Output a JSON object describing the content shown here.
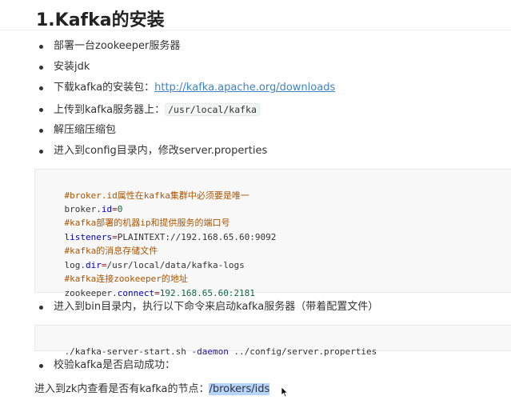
{
  "heading": {
    "title": "1.Kafka的安装"
  },
  "steps": [
    {
      "text": "部署一台zookeeper服务器"
    },
    {
      "text": "安装jdk"
    },
    {
      "text": "下载kafka的安装包：",
      "link": "http://kafka.apache.org/downloads"
    },
    {
      "text": "上传到kafka服务器上：",
      "code": "/usr/local/kafka"
    },
    {
      "text": "解压缩压缩包"
    },
    {
      "text": "进入到config目录内，修改server.properties"
    }
  ],
  "config_block": {
    "lines": [
      {
        "comment": "#broker.id属性在kafka集群中必须要是唯一"
      },
      {
        "prefix": "broker.",
        "prop": "id",
        "op": "=",
        "value": "0"
      },
      {
        "comment": "#kafka部署的机器ip和提供服务的端口号"
      },
      {
        "prop": "listeners",
        "op": "=",
        "value": "PLAINTEXT://192.168.65.60:9092"
      },
      {
        "comment": "#kafka的消息存储文件"
      },
      {
        "prefix": "log.",
        "prop": "dir",
        "op": "=",
        "value": "/usr/local/data/kafka-logs"
      },
      {
        "comment": "#kafka连接zookeeper的地址"
      },
      {
        "prefix": "zookeeper.",
        "prop": "connect",
        "op": "=",
        "value": "192.168.65.60:2181"
      }
    ]
  },
  "step_start": {
    "text": "进入到bin目录内，执行以下命令来启动kafka服务器（带着配置文件）"
  },
  "start_command": {
    "script": "./kafka-server-start.sh ",
    "flag": "-daemon",
    "args": " ../config/server.properties"
  },
  "step_verify": {
    "text": "校验kafka是否启动成功："
  },
  "verify_para": {
    "text": "进入到zk内查看是否有kafka的节点：",
    "selected": "/brokers/ids"
  }
}
